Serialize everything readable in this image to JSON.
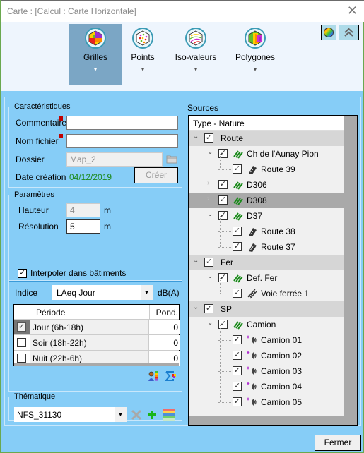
{
  "window": {
    "title": "Carte :  [Calcul : Carte Horizontale]",
    "close_icon": "close-icon"
  },
  "ribbon": {
    "buttons": [
      {
        "label": "Grilles",
        "icon": "grid-map-icon",
        "active": true
      },
      {
        "label": "Points",
        "icon": "points-map-icon",
        "active": false
      },
      {
        "label": "Iso-valeurs",
        "icon": "iso-lines-icon",
        "active": false
      },
      {
        "label": "Polygones",
        "icon": "polygons-map-icon",
        "active": false
      }
    ],
    "dropdown_arrow": "▾",
    "color_palette_icon": "color-palette-icon",
    "collapse_icon": "collapse-ribbon-icon"
  },
  "caracteristiques": {
    "legend": "Caractéristiques",
    "commentaire_label": "Commentaire",
    "commentaire_value": "",
    "nom_fichier_label": "Nom fichier",
    "nom_fichier_value": "",
    "dossier_label": "Dossier",
    "dossier_value": "Map_2",
    "date_label": "Date création",
    "date_value": "04/12/2019",
    "date_color": "#1e8a1e",
    "creer_label": "Créer"
  },
  "parametres": {
    "legend": "Paramètres",
    "hauteur_label": "Hauteur",
    "hauteur_value": "4",
    "hauteur_unit": "m",
    "resolution_label": "Résolution",
    "resolution_value": "5",
    "resolution_unit": "m",
    "interpoler_label": "Interpoler dans bâtiments",
    "interpoler_checked": true
  },
  "indice": {
    "label": "Indice",
    "selected": "LAeq Jour",
    "unit": "dB(A)",
    "table": {
      "headers": [
        "",
        "Période",
        "Pond."
      ],
      "rows": [
        {
          "checked": true,
          "periode": "Jour (6h-18h)",
          "pond": "0"
        },
        {
          "checked": false,
          "periode": "Soir (18h-22h)",
          "pond": "0"
        },
        {
          "checked": false,
          "periode": "Nuit (22h-6h)",
          "pond": "0"
        }
      ]
    }
  },
  "thematique": {
    "legend": "Thématique",
    "selected": "NFS_31130"
  },
  "sources": {
    "label": "Sources",
    "column_header": "Type - Nature",
    "nodes": [
      {
        "level": 0,
        "label": "Route",
        "type": "group",
        "expanded": true,
        "checked": true
      },
      {
        "level": 1,
        "label": "Ch de l'Aunay Pion",
        "icon": "road-line-icon",
        "expanded": true,
        "checked": true
      },
      {
        "level": 2,
        "label": "Route 39",
        "icon": "road-segment-icon",
        "checked": true
      },
      {
        "level": 1,
        "label": "D306",
        "icon": "road-line-icon",
        "expanded": false,
        "checked": true
      },
      {
        "level": 1,
        "label": "D308",
        "icon": "road-line-icon",
        "expanded": false,
        "checked": true,
        "selected": true
      },
      {
        "level": 1,
        "label": "D37",
        "icon": "road-line-icon",
        "expanded": true,
        "checked": true
      },
      {
        "level": 2,
        "label": "Route 38",
        "icon": "road-segment-icon",
        "checked": true
      },
      {
        "level": 2,
        "label": "Route 37",
        "icon": "road-segment-icon",
        "checked": true
      },
      {
        "level": 0,
        "label": "Fer",
        "type": "group",
        "expanded": true,
        "checked": true
      },
      {
        "level": 1,
        "label": "Def. Fer",
        "icon": "road-line-icon",
        "expanded": true,
        "checked": true
      },
      {
        "level": 2,
        "label": "Voie ferrée 1",
        "icon": "railway-icon",
        "checked": true
      },
      {
        "level": 0,
        "label": "SP",
        "type": "group",
        "expanded": true,
        "checked": true
      },
      {
        "level": 1,
        "label": "Camion",
        "icon": "road-line-icon",
        "expanded": true,
        "checked": true
      },
      {
        "level": 2,
        "label": "Camion 01",
        "icon": "point-source-icon",
        "checked": true
      },
      {
        "level": 2,
        "label": "Camion 02",
        "icon": "point-source-icon",
        "checked": true
      },
      {
        "level": 2,
        "label": "Camion 03",
        "icon": "point-source-icon",
        "checked": true
      },
      {
        "level": 2,
        "label": "Camion 04",
        "icon": "point-source-icon",
        "checked": true
      },
      {
        "level": 2,
        "label": "Camion 05",
        "icon": "point-source-icon",
        "checked": true
      }
    ]
  },
  "footer": {
    "fermer_label": "Fermer"
  },
  "colors": {
    "dialog_bg": "#86cdf7",
    "ribbon_bg": "#eef5fd",
    "ribbon_active": "#7ba6c5",
    "road_icon_green": "#1a8a1a",
    "required_marker": "#c00000"
  }
}
